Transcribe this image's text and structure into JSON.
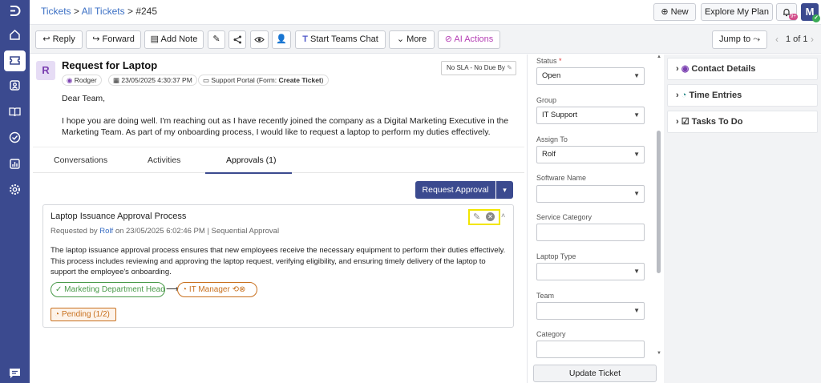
{
  "breadcrumb": {
    "tickets": "Tickets",
    "sep1": ">",
    "all": "All Tickets",
    "sep2": ">",
    "id": "#245"
  },
  "header": {
    "new_label": "New",
    "explore_label": "Explore My Plan",
    "notif_badge": "9+",
    "avatar_letter": "M"
  },
  "toolbar": {
    "reply": "Reply",
    "forward": "Forward",
    "add_note": "Add Note",
    "teams": "Start Teams Chat",
    "more": "More",
    "ai": "AI Actions",
    "jump": "Jump to",
    "pager": "1 of 1"
  },
  "ticket": {
    "avatar": "R",
    "title": "Request for Laptop",
    "requester": "Rodger",
    "date": "23/05/2025 4:30:37 PM",
    "source_prefix": "Support Portal (Form:",
    "source_form": "Create Ticket",
    "source_suffix": ")",
    "sla": "No SLA - No Due By",
    "greeting": "Dear Team,",
    "body": "I hope you are doing well. I'm reaching out as I have recently joined the company as a Digital Marketing Executive in the Marketing Team. As part of my onboarding process, I would like to request a laptop to perform my duties effectively."
  },
  "tabs": {
    "conversations": "Conversations",
    "activities": "Activities",
    "approvals": "Approvals (1)"
  },
  "approval": {
    "request_btn": "Request Approval",
    "title": "Laptop Issuance Approval Process",
    "requested_by_prefix": "Requested by",
    "requester": "Rolf",
    "requested_on": "on 23/05/2025 6:02:46 PM",
    "sep": "|",
    "mode": "Sequential Approval",
    "desc": "The laptop issuance approval process ensures that new employees receive the necessary equipment to perform their duties effectively. This process includes reviewing and approving the laptop request, verifying eligibility, and ensuring timely delivery of the laptop to support the employee's onboarding.",
    "step1": "Marketing Department Head",
    "arrow": "⟶",
    "step2": "IT Manager",
    "status": "Pending (1/2)"
  },
  "fields": {
    "status_label": "Status",
    "required": "*",
    "status_value": "Open",
    "group_label": "Group",
    "group_value": "IT Support",
    "assign_label": "Assign To",
    "assign_value": "Rolf",
    "software_label": "Software Name",
    "service_label": "Service Category",
    "laptop_label": "Laptop Type",
    "team_label": "Team",
    "category_label": "Category",
    "update_btn": "Update Ticket"
  },
  "panels": {
    "contact": "Contact Details",
    "time": "Time Entries",
    "tasks": "Tasks To Do"
  },
  "colors": {
    "rail": "#3b4a8f",
    "primary": "#3b4a8f",
    "success": "#4a9a4a",
    "warning": "#c8701e",
    "highlight": "#f2e600",
    "ai": "#b540b5"
  }
}
